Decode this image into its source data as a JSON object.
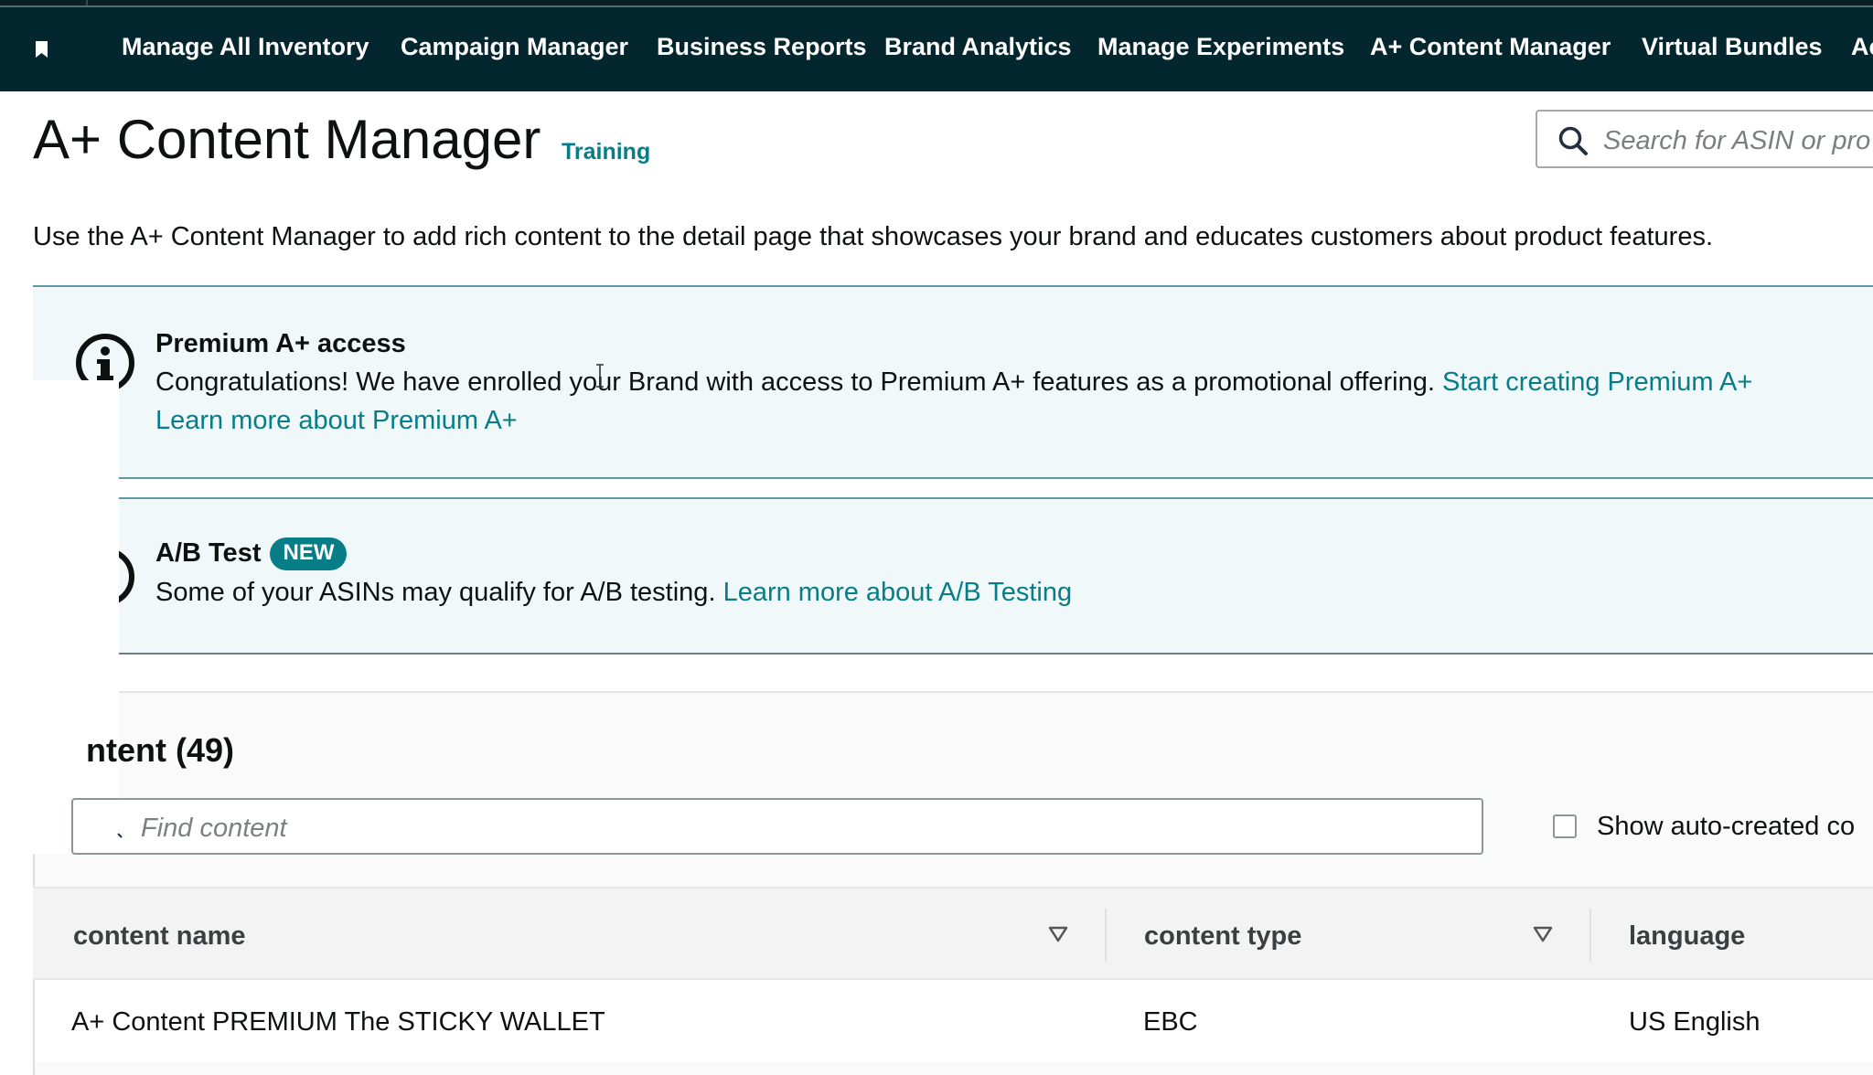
{
  "nav": {
    "items": [
      {
        "label": "Manage All Inventory"
      },
      {
        "label": "Campaign Manager"
      },
      {
        "label": "Business Reports"
      },
      {
        "label": "Brand Analytics"
      },
      {
        "label": "Manage Experiments"
      },
      {
        "label": "A+ Content Manager"
      },
      {
        "label": "Virtual Bundles"
      },
      {
        "label": "Ac"
      }
    ],
    "bookmark_icon": "bookmark-icon"
  },
  "header": {
    "title": "A+ Content Manager",
    "training_link": "Training"
  },
  "search": {
    "placeholder": "Search for ASIN or pro",
    "icon": "search-icon"
  },
  "intro": "Use the A+ Content Manager to add rich content to the detail page that showcases your brand and educates customers about product features.",
  "alerts": {
    "premium": {
      "icon": "info-icon",
      "title": "Premium A+ access",
      "body": "Congratulations! We have enrolled your Brand with access to Premium A+ features as a promotional offering.",
      "link_start": "Start creating Premium A+",
      "link_learn": "Learn more about Premium A+"
    },
    "ab_test": {
      "title": "A/B Test",
      "badge": "NEW",
      "body": "Some of your ASINs may qualify for A/B testing.",
      "link": "Learn more about A/B Testing"
    }
  },
  "content": {
    "heading": "ntent (49)",
    "find_placeholder": "Find content",
    "show_auto_label": "Show auto-created co",
    "table": {
      "columns": [
        {
          "label": "content name"
        },
        {
          "label": "content type"
        },
        {
          "label": "language"
        }
      ],
      "rows": [
        {
          "name": "A+ Content PREMIUM The STICKY WALLET",
          "type": "EBC",
          "language": "US English"
        }
      ]
    }
  },
  "colors": {
    "nav_bg": "#04262e",
    "link": "#077d87",
    "alert_bg": "#f1f8fa"
  }
}
